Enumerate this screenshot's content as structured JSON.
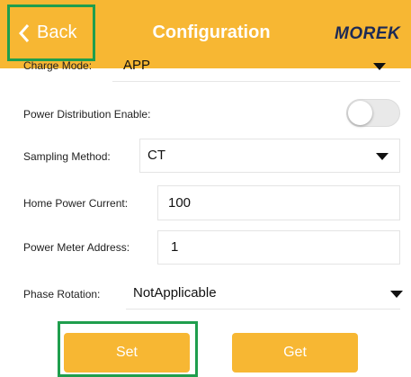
{
  "header": {
    "back_label": "Back",
    "title": "Configuration",
    "logo": "MOREK",
    "background_color": "#f7b733",
    "back_icon": "chevron-left-icon"
  },
  "fields": {
    "charge_mode": {
      "label": "Charge Mode:",
      "value": "APP"
    },
    "power_distribution": {
      "label": "Power Distribution Enable:",
      "enabled": false
    },
    "sampling_method": {
      "label": "Sampling Method:",
      "value": "CT"
    },
    "home_power_current": {
      "label": "Home Power Current:",
      "value": "100"
    },
    "power_meter_address": {
      "label": "Power Meter Address:",
      "value": "1"
    },
    "phase_rotation": {
      "label": "Phase Rotation:",
      "value": "NotApplicable"
    }
  },
  "buttons": {
    "set_label": "Set",
    "get_label": "Get",
    "color": "#f7b733"
  },
  "highlight_color": "#1f9e4d"
}
